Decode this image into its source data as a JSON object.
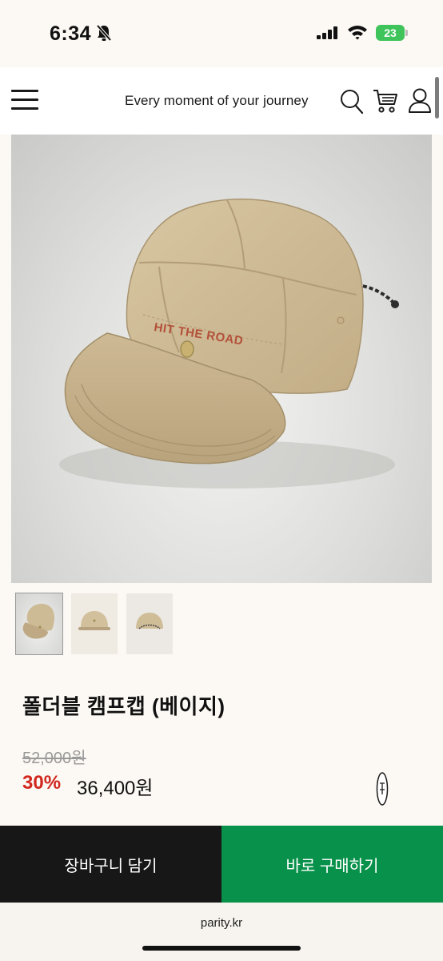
{
  "status_bar": {
    "time": "6:34",
    "battery": "23"
  },
  "header": {
    "tagline": "Every moment of your journey",
    "icons": [
      "menu-icon",
      "search-icon",
      "cart-icon",
      "user-icon"
    ]
  },
  "product": {
    "image_text": "HIT THE ROAD",
    "name": "폴더블 캠프캡 (베이지)",
    "original_price": "52,000원",
    "discount": "30%",
    "sale_price": "36,400원"
  },
  "actions": {
    "cart_label": "장바구니 담기",
    "buy_label": "바로 구매하기"
  },
  "browser": {
    "url": "parity.kr"
  },
  "colors": {
    "discount": "#d1271f",
    "buy_button": "#08914a",
    "cart_button": "#171717",
    "background": "#fcf8f3"
  }
}
